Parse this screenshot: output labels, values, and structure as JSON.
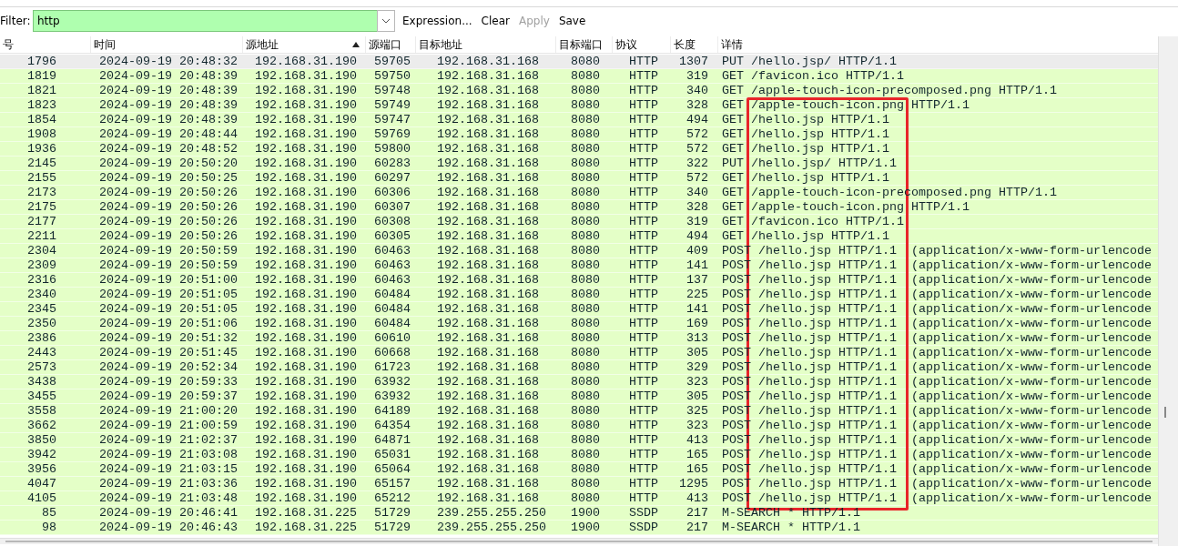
{
  "filter": {
    "label": "Filter:",
    "value": "http",
    "buttons": [
      {
        "label": "Expression...",
        "disabled": false
      },
      {
        "label": "Clear",
        "disabled": false
      },
      {
        "label": "Apply",
        "disabled": true
      },
      {
        "label": "Save",
        "disabled": false
      }
    ]
  },
  "columns": [
    {
      "label": "号",
      "sorted": false
    },
    {
      "label": "时间",
      "sorted": false
    },
    {
      "label": "源地址",
      "sorted": true
    },
    {
      "label": "源端口",
      "sorted": false
    },
    {
      "label": "目标地址",
      "sorted": false
    },
    {
      "label": "目标端口",
      "sorted": false
    },
    {
      "label": "协议",
      "sorted": false
    },
    {
      "label": "长度",
      "sorted": false
    },
    {
      "label": "详情",
      "sorted": false
    }
  ],
  "rows": [
    {
      "selected": true,
      "cells": [
        "1796",
        "2024-09-19 20:48:32",
        "192.168.31.190",
        "59705",
        "192.168.31.168",
        "8080",
        "HTTP",
        "1307",
        "PUT /hello.jsp/ HTTP/1.1"
      ]
    },
    {
      "selected": false,
      "cells": [
        "1819",
        "2024-09-19 20:48:39",
        "192.168.31.190",
        "59750",
        "192.168.31.168",
        "8080",
        "HTTP",
        "319",
        "GET /favicon.ico HTTP/1.1"
      ]
    },
    {
      "selected": false,
      "cells": [
        "1821",
        "2024-09-19 20:48:39",
        "192.168.31.190",
        "59748",
        "192.168.31.168",
        "8080",
        "HTTP",
        "340",
        "GET /apple-touch-icon-precomposed.png HTTP/1.1"
      ]
    },
    {
      "selected": false,
      "cells": [
        "1823",
        "2024-09-19 20:48:39",
        "192.168.31.190",
        "59749",
        "192.168.31.168",
        "8080",
        "HTTP",
        "328",
        "GET /apple-touch-icon.png HTTP/1.1"
      ]
    },
    {
      "selected": false,
      "cells": [
        "1854",
        "2024-09-19 20:48:39",
        "192.168.31.190",
        "59747",
        "192.168.31.168",
        "8080",
        "HTTP",
        "494",
        "GET /hello.jsp HTTP/1.1"
      ]
    },
    {
      "selected": false,
      "cells": [
        "1908",
        "2024-09-19 20:48:44",
        "192.168.31.190",
        "59769",
        "192.168.31.168",
        "8080",
        "HTTP",
        "572",
        "GET /hello.jsp HTTP/1.1"
      ]
    },
    {
      "selected": false,
      "cells": [
        "1936",
        "2024-09-19 20:48:52",
        "192.168.31.190",
        "59800",
        "192.168.31.168",
        "8080",
        "HTTP",
        "572",
        "GET /hello.jsp HTTP/1.1"
      ]
    },
    {
      "selected": false,
      "cells": [
        "2145",
        "2024-09-19 20:50:20",
        "192.168.31.190",
        "60283",
        "192.168.31.168",
        "8080",
        "HTTP",
        "322",
        "PUT /hello.jsp/ HTTP/1.1"
      ]
    },
    {
      "selected": false,
      "cells": [
        "2155",
        "2024-09-19 20:50:25",
        "192.168.31.190",
        "60297",
        "192.168.31.168",
        "8080",
        "HTTP",
        "572",
        "GET /hello.jsp HTTP/1.1"
      ]
    },
    {
      "selected": false,
      "cells": [
        "2173",
        "2024-09-19 20:50:26",
        "192.168.31.190",
        "60306",
        "192.168.31.168",
        "8080",
        "HTTP",
        "340",
        "GET /apple-touch-icon-precomposed.png HTTP/1.1"
      ]
    },
    {
      "selected": false,
      "cells": [
        "2175",
        "2024-09-19 20:50:26",
        "192.168.31.190",
        "60307",
        "192.168.31.168",
        "8080",
        "HTTP",
        "328",
        "GET /apple-touch-icon.png HTTP/1.1"
      ]
    },
    {
      "selected": false,
      "cells": [
        "2177",
        "2024-09-19 20:50:26",
        "192.168.31.190",
        "60308",
        "192.168.31.168",
        "8080",
        "HTTP",
        "319",
        "GET /favicon.ico HTTP/1.1"
      ]
    },
    {
      "selected": false,
      "cells": [
        "2211",
        "2024-09-19 20:50:26",
        "192.168.31.190",
        "60305",
        "192.168.31.168",
        "8080",
        "HTTP",
        "494",
        "GET /hello.jsp HTTP/1.1"
      ]
    },
    {
      "selected": false,
      "cells": [
        "2304",
        "2024-09-19 20:50:59",
        "192.168.31.190",
        "60463",
        "192.168.31.168",
        "8080",
        "HTTP",
        "409",
        "POST /hello.jsp HTTP/1.1  (application/x-www-form-urlencode"
      ]
    },
    {
      "selected": false,
      "cells": [
        "2309",
        "2024-09-19 20:50:59",
        "192.168.31.190",
        "60463",
        "192.168.31.168",
        "8080",
        "HTTP",
        "141",
        "POST /hello.jsp HTTP/1.1  (application/x-www-form-urlencode"
      ]
    },
    {
      "selected": false,
      "cells": [
        "2316",
        "2024-09-19 20:51:00",
        "192.168.31.190",
        "60463",
        "192.168.31.168",
        "8080",
        "HTTP",
        "137",
        "POST /hello.jsp HTTP/1.1  (application/x-www-form-urlencode"
      ]
    },
    {
      "selected": false,
      "cells": [
        "2340",
        "2024-09-19 20:51:05",
        "192.168.31.190",
        "60484",
        "192.168.31.168",
        "8080",
        "HTTP",
        "225",
        "POST /hello.jsp HTTP/1.1  (application/x-www-form-urlencode"
      ]
    },
    {
      "selected": false,
      "cells": [
        "2345",
        "2024-09-19 20:51:05",
        "192.168.31.190",
        "60484",
        "192.168.31.168",
        "8080",
        "HTTP",
        "141",
        "POST /hello.jsp HTTP/1.1  (application/x-www-form-urlencode"
      ]
    },
    {
      "selected": false,
      "cells": [
        "2350",
        "2024-09-19 20:51:06",
        "192.168.31.190",
        "60484",
        "192.168.31.168",
        "8080",
        "HTTP",
        "169",
        "POST /hello.jsp HTTP/1.1  (application/x-www-form-urlencode"
      ]
    },
    {
      "selected": false,
      "cells": [
        "2386",
        "2024-09-19 20:51:32",
        "192.168.31.190",
        "60610",
        "192.168.31.168",
        "8080",
        "HTTP",
        "313",
        "POST /hello.jsp HTTP/1.1  (application/x-www-form-urlencode"
      ]
    },
    {
      "selected": false,
      "cells": [
        "2443",
        "2024-09-19 20:51:45",
        "192.168.31.190",
        "60668",
        "192.168.31.168",
        "8080",
        "HTTP",
        "305",
        "POST /hello.jsp HTTP/1.1  (application/x-www-form-urlencode"
      ]
    },
    {
      "selected": false,
      "cells": [
        "2573",
        "2024-09-19 20:52:34",
        "192.168.31.190",
        "61723",
        "192.168.31.168",
        "8080",
        "HTTP",
        "329",
        "POST /hello.jsp HTTP/1.1  (application/x-www-form-urlencode"
      ]
    },
    {
      "selected": false,
      "cells": [
        "3438",
        "2024-09-19 20:59:33",
        "192.168.31.190",
        "63932",
        "192.168.31.168",
        "8080",
        "HTTP",
        "323",
        "POST /hello.jsp HTTP/1.1  (application/x-www-form-urlencode"
      ]
    },
    {
      "selected": false,
      "cells": [
        "3455",
        "2024-09-19 20:59:37",
        "192.168.31.190",
        "63932",
        "192.168.31.168",
        "8080",
        "HTTP",
        "305",
        "POST /hello.jsp HTTP/1.1  (application/x-www-form-urlencode"
      ]
    },
    {
      "selected": false,
      "cells": [
        "3558",
        "2024-09-19 21:00:20",
        "192.168.31.190",
        "64189",
        "192.168.31.168",
        "8080",
        "HTTP",
        "325",
        "POST /hello.jsp HTTP/1.1  (application/x-www-form-urlencode"
      ]
    },
    {
      "selected": false,
      "cells": [
        "3662",
        "2024-09-19 21:00:59",
        "192.168.31.190",
        "64354",
        "192.168.31.168",
        "8080",
        "HTTP",
        "323",
        "POST /hello.jsp HTTP/1.1  (application/x-www-form-urlencode"
      ]
    },
    {
      "selected": false,
      "cells": [
        "3850",
        "2024-09-19 21:02:37",
        "192.168.31.190",
        "64871",
        "192.168.31.168",
        "8080",
        "HTTP",
        "413",
        "POST /hello.jsp HTTP/1.1  (application/x-www-form-urlencode"
      ]
    },
    {
      "selected": false,
      "cells": [
        "3942",
        "2024-09-19 21:03:08",
        "192.168.31.190",
        "65031",
        "192.168.31.168",
        "8080",
        "HTTP",
        "165",
        "POST /hello.jsp HTTP/1.1  (application/x-www-form-urlencode"
      ]
    },
    {
      "selected": false,
      "cells": [
        "3956",
        "2024-09-19 21:03:15",
        "192.168.31.190",
        "65064",
        "192.168.31.168",
        "8080",
        "HTTP",
        "165",
        "POST /hello.jsp HTTP/1.1  (application/x-www-form-urlencode"
      ]
    },
    {
      "selected": false,
      "cells": [
        "4047",
        "2024-09-19 21:03:36",
        "192.168.31.190",
        "65157",
        "192.168.31.168",
        "8080",
        "HTTP",
        "1295",
        "POST /hello.jsp HTTP/1.1  (application/x-www-form-urlencode"
      ]
    },
    {
      "selected": false,
      "cells": [
        "4105",
        "2024-09-19 21:03:48",
        "192.168.31.190",
        "65212",
        "192.168.31.168",
        "8080",
        "HTTP",
        "413",
        "POST /hello.jsp HTTP/1.1  (application/x-www-form-urlencode"
      ]
    },
    {
      "selected": false,
      "cells": [
        "85",
        "2024-09-19 20:46:41",
        "192.168.31.225",
        "51729",
        "239.255.255.250",
        "1900",
        "SSDP",
        "217",
        "M-SEARCH * HTTP/1.1"
      ]
    },
    {
      "selected": false,
      "cells": [
        "98",
        "2024-09-19 20:46:43",
        "192.168.31.225",
        "51729",
        "239.255.255.250",
        "1900",
        "SSDP",
        "217",
        "M-SEARCH * HTTP/1.1"
      ]
    }
  ]
}
